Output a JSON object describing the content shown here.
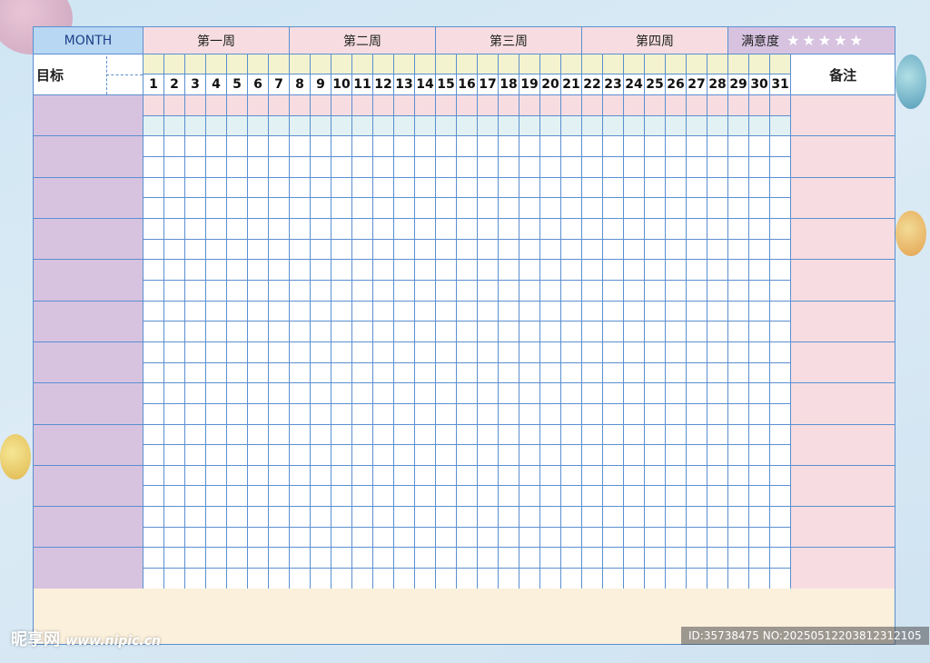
{
  "header": {
    "month_label": "MONTH",
    "weeks": [
      "第一周",
      "第二周",
      "第三周",
      "第四周"
    ],
    "satisfaction_label": "满意度",
    "stars": "★★★★★",
    "goal_label": "目标",
    "notes_label": "备注"
  },
  "days": [
    "1",
    "2",
    "3",
    "4",
    "5",
    "6",
    "7",
    "8",
    "9",
    "10",
    "11",
    "12",
    "13",
    "14",
    "15",
    "16",
    "17",
    "18",
    "19",
    "20",
    "21",
    "22",
    "23",
    "24",
    "25",
    "26",
    "27",
    "28",
    "29",
    "30",
    "31"
  ],
  "goal_rows": 12,
  "watermark": {
    "left": "昵享网",
    "left_url": "www.nipic.cn",
    "right": "ID:35738475 NO:20250512203812312105"
  },
  "colors": {
    "grid_line": "#5b8fd0",
    "goal_fill": "#d7c3e0",
    "note_fill": "#f7dde1",
    "month_fill": "#b7d7f2",
    "footer_fill": "#fbf0dc"
  }
}
